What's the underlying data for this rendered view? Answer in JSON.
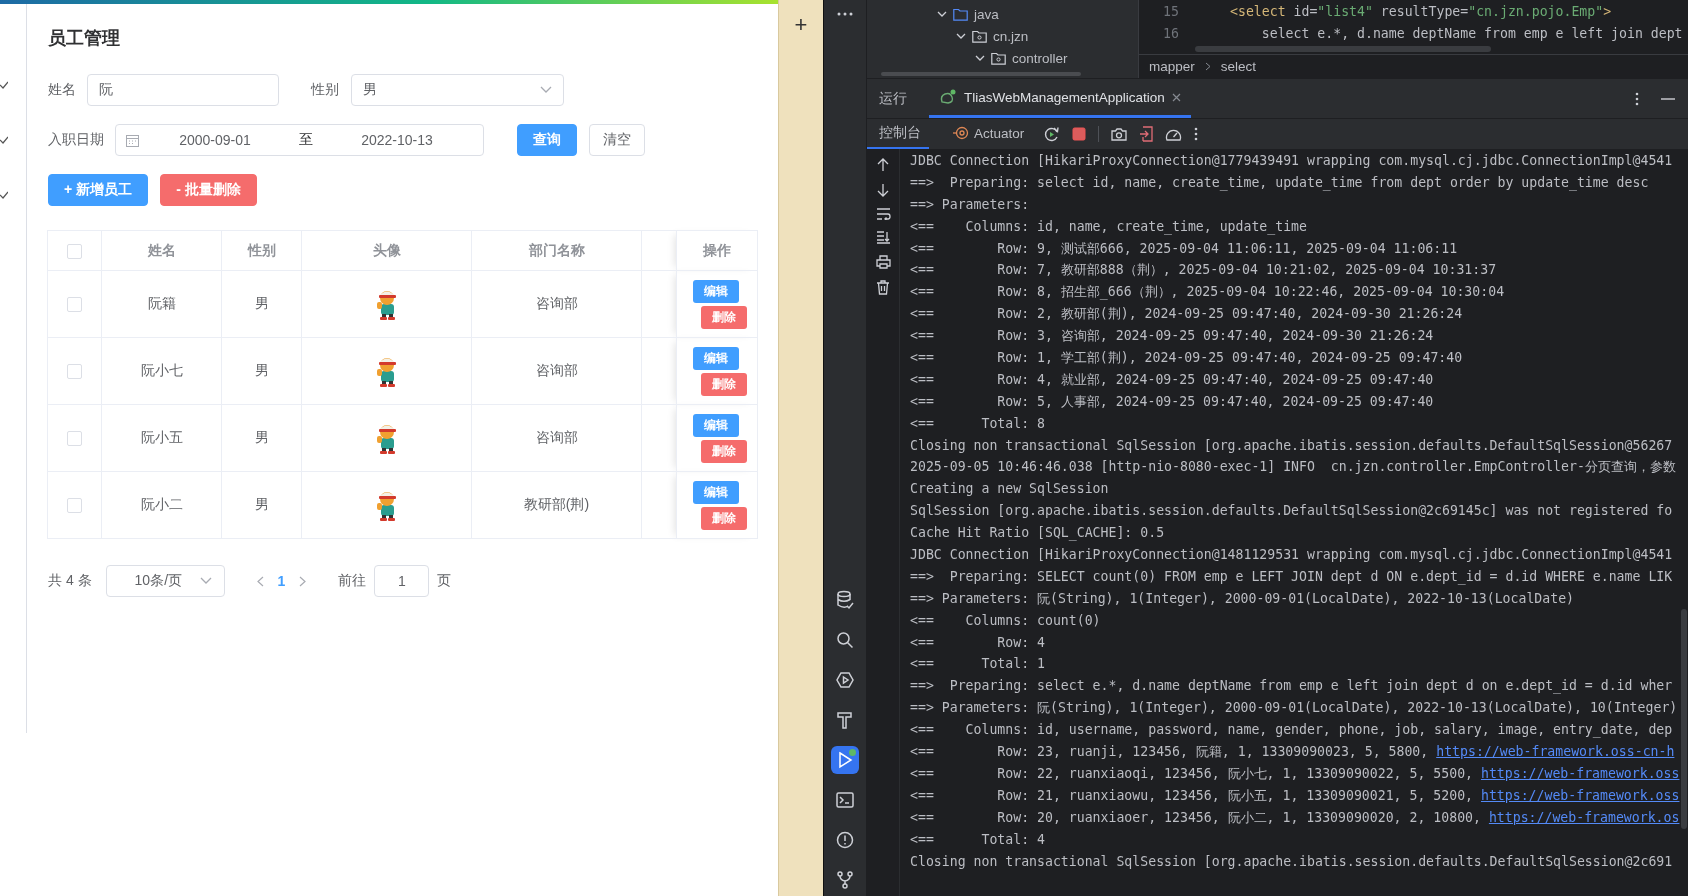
{
  "browser": {
    "title": "员工管理",
    "search_form": {
      "name_label": "姓名",
      "name_value": "阮",
      "gender_label": "性别",
      "gender_value": "男",
      "date_label": "入职日期",
      "date_start": "2000-09-01",
      "date_separator": "至",
      "date_end": "2022-10-13",
      "query_button": "查询",
      "clear_button": "清空"
    },
    "actions": {
      "add_button": "+ 新增员工",
      "batch_delete_button": "- 批量删除"
    },
    "table": {
      "select_all_checked": false,
      "columns": [
        "姓名",
        "性别",
        "头像",
        "部门名称",
        "操作"
      ],
      "rows": [
        {
          "checked": false,
          "name": "阮籍",
          "gender": "男",
          "dept": "咨询部",
          "edit": "编辑",
          "delete": "删除"
        },
        {
          "checked": false,
          "name": "阮小七",
          "gender": "男",
          "dept": "咨询部",
          "edit": "编辑",
          "delete": "删除"
        },
        {
          "checked": false,
          "name": "阮小五",
          "gender": "男",
          "dept": "咨询部",
          "edit": "编辑",
          "delete": "删除"
        },
        {
          "checked": false,
          "name": "阮小二",
          "gender": "男",
          "dept": "教研部(荆)",
          "edit": "编辑",
          "delete": "删除"
        }
      ]
    },
    "pagination": {
      "total": "共 4 条",
      "page_size": "10条/页",
      "pages": [
        {
          "label": "1",
          "selected": true
        }
      ],
      "goto_label": "前往",
      "goto_value": "1",
      "goto_suffix": "页"
    }
  },
  "side_panel": {
    "add": "+"
  },
  "ide": {
    "project_tree": [
      {
        "label": "java",
        "kind": "source",
        "expanded": true,
        "children": [
          {
            "label": "cn.jzn",
            "kind": "package",
            "expanded": true,
            "children": [
              {
                "label": "controller",
                "kind": "package",
                "expanded": true
              }
            ]
          }
        ]
      }
    ],
    "editor": {
      "lines": [
        {
          "number": "15",
          "segments": [
            {
              "kind": "tag",
              "text": "<select"
            },
            {
              "kind": "attr",
              "text": " id="
            },
            {
              "kind": "value",
              "text": "\"list4\""
            },
            {
              "kind": "attr",
              "text": " resultType="
            },
            {
              "kind": "value",
              "text": "\"cn.jzn.pojo.Emp\""
            },
            {
              "kind": "tag",
              "text": ">"
            }
          ]
        },
        {
          "number": "16",
          "segments": [
            {
              "kind": "plain",
              "text": "    select e.*, d.name deptName from emp e left join dept"
            }
          ]
        }
      ],
      "breadcrumb": [
        "mapper",
        "select"
      ]
    },
    "run_panel": {
      "title": "运行",
      "tabs": [
        {
          "label": "TliasWebManagementApplication",
          "selected": true
        }
      ],
      "console_tabs": [
        {
          "label": "控制台",
          "selected": true
        },
        {
          "label": "Actuator",
          "selected": false
        }
      ]
    },
    "console": [
      {
        "text": "JDBC Connection [HikariProxyConnection@1779439491 wrapping com.mysql.cj.jdbc.ConnectionImpl@4541"
      },
      {
        "text": "==>  Preparing: select id, name, create_time, update_time from dept order by update_time desc"
      },
      {
        "text": "==> Parameters:"
      },
      {
        "text": "<==    Columns: id, name, create_time, update_time"
      },
      {
        "text": "<==        Row: 9, 测试部666, 2025-09-04 11:06:11, 2025-09-04 11:06:11"
      },
      {
        "text": "<==        Row: 7, 教研部888（荆）, 2025-09-04 10:21:02, 2025-09-04 10:31:37"
      },
      {
        "text": "<==        Row: 8, 招生部_666（荆）, 2025-09-04 10:22:46, 2025-09-04 10:30:04"
      },
      {
        "text": "<==        Row: 2, 教研部(荆), 2024-09-25 09:47:40, 2024-09-30 21:26:24"
      },
      {
        "text": "<==        Row: 3, 咨询部, 2024-09-25 09:47:40, 2024-09-30 21:26:24"
      },
      {
        "text": "<==        Row: 1, 学工部(荆), 2024-09-25 09:47:40, 2024-09-25 09:47:40"
      },
      {
        "text": "<==        Row: 4, 就业部, 2024-09-25 09:47:40, 2024-09-25 09:47:40"
      },
      {
        "text": "<==        Row: 5, 人事部, 2024-09-25 09:47:40, 2024-09-25 09:47:40"
      },
      {
        "text": "<==      Total: 8"
      },
      {
        "text": "Closing non transactional SqlSession [org.apache.ibatis.session.defaults.DefaultSqlSession@56267"
      },
      {
        "text": "2025-09-05 10:46:46.038 [http-nio-8080-exec-1] INFO  cn.jzn.controller.EmpController-分页查询，参数"
      },
      {
        "text": "Creating a new SqlSession"
      },
      {
        "text": "SqlSession [org.apache.ibatis.session.defaults.DefaultSqlSession@2c69145c] was not registered fo"
      },
      {
        "text": "Cache Hit Ratio [SQL_CACHE]: 0.5"
      },
      {
        "text": "JDBC Connection [HikariProxyConnection@1481129531 wrapping com.mysql.cj.jdbc.ConnectionImpl@4541"
      },
      {
        "text": "==>  Preparing: SELECT count(0) FROM emp e LEFT JOIN dept d ON e.dept_id = d.id WHERE e.name LIK"
      },
      {
        "text": "==> Parameters: 阮(String), 1(Integer), 2000-09-01(LocalDate), 2022-10-13(LocalDate)"
      },
      {
        "text": "<==    Columns: count(0)"
      },
      {
        "text": "<==        Row: 4"
      },
      {
        "text": "<==      Total: 1"
      },
      {
        "text": "==>  Preparing: select e.*, d.name deptName from emp e left join dept d on e.dept_id = d.id wher"
      },
      {
        "text": "==> Parameters: 阮(String), 1(Integer), 2000-09-01(LocalDate), 2022-10-13(LocalDate), 10(Integer)"
      },
      {
        "text": "<==    Columns: id, username, password, name, gender, phone, job, salary, image, entry_date, dep"
      },
      {
        "text": "<==        Row: 23, ruanji, 123456, 阮籍, 1, 13309090023, 5, 5800, ",
        "link": "https://web-framework.oss-cn-h"
      },
      {
        "text": "<==        Row: 22, ruanxiaoqi, 123456, 阮小七, 1, 13309090022, 5, 5500, ",
        "link": "https://web-framework.oss"
      },
      {
        "text": "<==        Row: 21, ruanxiaowu, 123456, 阮小五, 1, 13309090021, 5, 5200, ",
        "link": "https://web-framework.oss"
      },
      {
        "text": "<==        Row: 20, ruanxiaoer, 123456, 阮小二, 1, 13309090020, 2, 10800, ",
        "link": "https://web-framework.os"
      },
      {
        "text": "<==      Total: 4"
      },
      {
        "text": "Closing non transactional SqlSession [org.apache.ibatis.session.defaults.DefaultSqlSession@2c691"
      }
    ],
    "tool_strip": [
      {
        "kind": "database",
        "selected": false
      },
      {
        "kind": "search",
        "selected": false
      },
      {
        "kind": "services",
        "selected": false
      },
      {
        "kind": "build",
        "selected": false
      },
      {
        "kind": "run",
        "selected": true
      },
      {
        "kind": "terminal",
        "selected": false
      },
      {
        "kind": "problems",
        "selected": false
      },
      {
        "kind": "git",
        "selected": false
      }
    ]
  }
}
